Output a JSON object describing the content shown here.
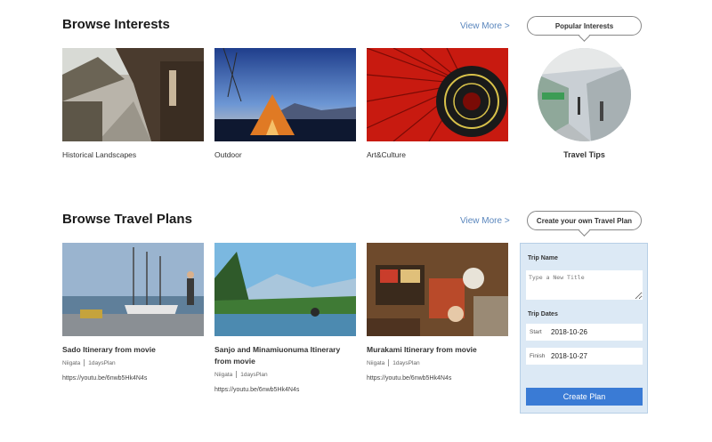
{
  "interests": {
    "title": "Browse Interests",
    "view_more": "View More >",
    "items": [
      {
        "label": "Historical Landscapes"
      },
      {
        "label": "Outdoor"
      },
      {
        "label": "Art&Culture"
      }
    ],
    "popular": {
      "bubble": "Popular Interests",
      "label": "Travel Tips"
    }
  },
  "plans": {
    "title": "Browse Travel Plans",
    "view_more": "View More >",
    "items": [
      {
        "title": "Sado Itinerary from movie",
        "place": "Niigata",
        "plan": "1daysPlan",
        "link": "https://youtu.be/6nwb5Hk4N4s"
      },
      {
        "title": "Sanjo and Minamiuonuma Itinerary from movie",
        "place": "Niigata",
        "plan": "1daysPlan",
        "link": "https://youtu.be/6nwb5Hk4N4s"
      },
      {
        "title": "Murakami Itinerary from movie",
        "place": "Niigata",
        "plan": "1daysPlan",
        "link": "https://youtu.be/6nwb5Hk4N4s"
      }
    ]
  },
  "create": {
    "bubble": "Create your own Travel Plan",
    "trip_name_label": "Trip Name",
    "trip_name_placeholder": "Type a New Title",
    "trip_dates_label": "Trip Dates",
    "start_label": "Start",
    "start_value": "2018-10-26",
    "finish_label": "Finish",
    "finish_value": "2018-10-27",
    "button": "Create Plan"
  }
}
